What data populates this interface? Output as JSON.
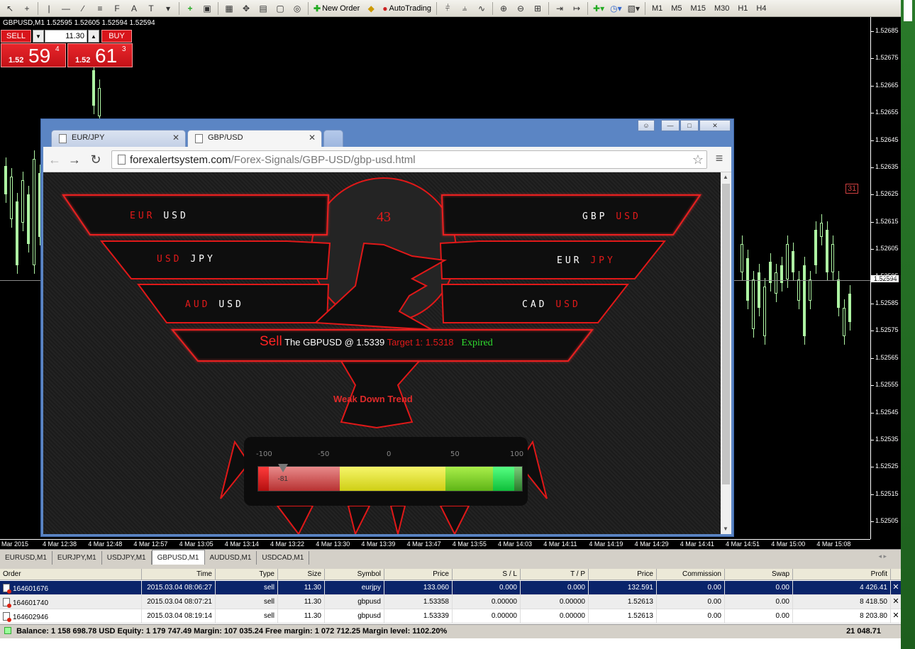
{
  "toolbar": {
    "new_order_label": "New Order",
    "autotrading_label": "AutoTrading",
    "timeframes": [
      "M1",
      "M5",
      "M15",
      "M30",
      "H1",
      "H4"
    ]
  },
  "chart": {
    "header": "GBPUSD,M1  1.52595 1.52605 1.52594 1.52594",
    "price_ticks": [
      "1.52685",
      "1.52675",
      "1.52665",
      "1.52655",
      "1.52645",
      "1.52635",
      "1.52625",
      "1.52615",
      "1.52605",
      "1.52595",
      "1.52585",
      "1.52575",
      "1.52565",
      "1.52555",
      "1.52545",
      "1.52535",
      "1.52525",
      "1.52515",
      "1.52505"
    ],
    "current_price": "1.52594",
    "time_labels": [
      "Mar 2015",
      "4 Mar 12:38",
      "4 Mar 12:48",
      "4 Mar 12:57",
      "4 Mar 13:05",
      "4 Mar 13:14",
      "4 Mar 13:22",
      "4 Mar 13:30",
      "4 Mar 13:39",
      "4 Mar 13:47",
      "4 Mar 13:55",
      "4 Mar 14:03",
      "4 Mar 14:11",
      "4 Mar 14:19",
      "4 Mar 14:29",
      "4 Mar 14:41",
      "4 Mar 14:51",
      "4 Mar 15:00",
      "4 Mar 15:08"
    ],
    "marker": "31",
    "candle_color": "#aef5a3"
  },
  "one_click": {
    "sell_label": "SELL",
    "buy_label": "BUY",
    "volume": "11.30",
    "sell_small": "1.52",
    "sell_big": "59",
    "sell_sup": "4",
    "buy_small": "1.52",
    "buy_big": "61",
    "buy_sup": "3"
  },
  "browser": {
    "tabs": [
      {
        "label": "EUR/JPY"
      },
      {
        "label": "GBP/USD"
      }
    ],
    "url_domain": "forexalertsystem.com",
    "url_path": "/Forex-Signals/GBP-USD/gbp-usd.html"
  },
  "site": {
    "pairs_left": [
      {
        "base": "EUR",
        "quote": "USD"
      },
      {
        "base": "USD",
        "quote": "JPY"
      },
      {
        "base": "AUD",
        "quote": "USD"
      }
    ],
    "pairs_right": [
      {
        "base": "GBP",
        "quote": "USD"
      },
      {
        "base": "EUR",
        "quote": "JPY"
      },
      {
        "base": "CAD",
        "quote": "USD"
      }
    ],
    "signal_number": "43",
    "signal": {
      "action": "Sell",
      "text": "The GBPUSD @ 1.5339",
      "target": "Target 1: 1.5318",
      "status": "Expired"
    },
    "trend": "Weak Down Trend",
    "meter": {
      "ticks": [
        "-100",
        "-50",
        "0",
        "50",
        "100"
      ],
      "value": -81,
      "value_label": "-81"
    },
    "accent": "#e21a1a"
  },
  "terminal": {
    "tabs": [
      "EURUSD,M1",
      "EURJPY,M1",
      "USDJPY,M1",
      "GBPUSD,M1",
      "AUDUSD,M1",
      "USDCAD,M1"
    ],
    "active_tab": 3,
    "columns": [
      "Order",
      "Time",
      "Type",
      "Size",
      "Symbol",
      "Price",
      "S / L",
      "T / P",
      "Price",
      "Commission",
      "Swap",
      "Profit"
    ],
    "rows": [
      [
        "164601676",
        "2015.03.04 08:06:27",
        "sell",
        "11.30",
        "eurjpy",
        "133.060",
        "0.000",
        "0.000",
        "132.591",
        "0.00",
        "0.00",
        "4 426.41"
      ],
      [
        "164601740",
        "2015.03.04 08:07:21",
        "sell",
        "11.30",
        "gbpusd",
        "1.53358",
        "0.00000",
        "0.00000",
        "1.52613",
        "0.00",
        "0.00",
        "8 418.50"
      ],
      [
        "164602946",
        "2015.03.04 08:19:14",
        "sell",
        "11.30",
        "gbpusd",
        "1.53339",
        "0.00000",
        "0.00000",
        "1.52613",
        "0.00",
        "0.00",
        "8 203.80"
      ]
    ],
    "balance_text": "Balance: 1 158 698.78 USD  Equity: 1 179 747.49  Margin: 107 035.24  Free margin: 1 072 712.25  Margin level: 1102.20%",
    "total_profit": "21 048.71"
  }
}
